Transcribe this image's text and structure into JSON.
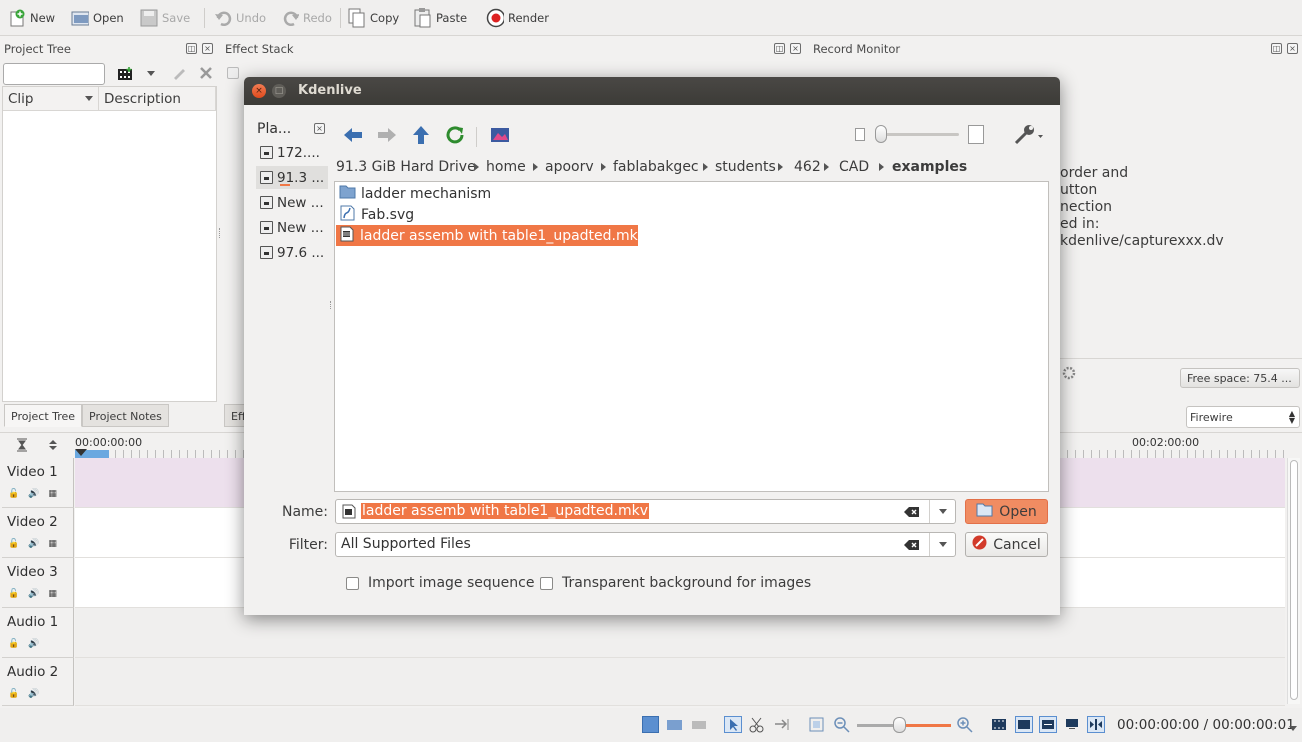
{
  "toolbar": {
    "new": "New",
    "open": "Open",
    "save": "Save",
    "undo": "Undo",
    "redo": "Redo",
    "copy": "Copy",
    "paste": "Paste",
    "render": "Render"
  },
  "project_tree": {
    "title": "Project Tree",
    "columns": [
      "Clip",
      "Description"
    ],
    "tabs": [
      "Project Tree",
      "Project Notes"
    ]
  },
  "effect_stack": {
    "title": "Effect Stack",
    "tab_partial": "Eff"
  },
  "record_monitor": {
    "title": "Record Monitor",
    "text_lines": [
      "order and",
      "utton",
      "nection",
      "ed in:",
      "kdenlive/capturexxx.dv"
    ],
    "free_space": "Free space: 75.4 ...",
    "device": "Firewire"
  },
  "timeline": {
    "start_time": "00:00:00:00",
    "mark_time": "00:02:00:00",
    "tracks": [
      {
        "name": "Video 1",
        "type": "video"
      },
      {
        "name": "Video 2",
        "type": "video"
      },
      {
        "name": "Video 3",
        "type": "video"
      },
      {
        "name": "Audio 1",
        "type": "audio"
      },
      {
        "name": "Audio 2",
        "type": "audio"
      }
    ]
  },
  "statusbar": {
    "timecode": "00:00:00:00 / 00:00:00:01"
  },
  "dialog": {
    "title": "Kdenlive",
    "places_title": "Pla...",
    "places": [
      "172....",
      "91.3 ...",
      "New ...",
      "New ...",
      "97.6 ..."
    ],
    "breadcrumb": [
      "91.3 GiB Hard Drive",
      "home",
      "apoorv",
      "fablabakgec",
      "students",
      "462",
      "CAD",
      "examples"
    ],
    "files": [
      {
        "name": "ladder mechanism",
        "kind": "folder"
      },
      {
        "name": "Fab.svg",
        "kind": "svg"
      },
      {
        "name": "ladder assemb with table1_upadted.mkv",
        "kind": "video",
        "selected": true
      }
    ],
    "name_label": "Name:",
    "name_value": "ladder assemb with table1_upadted.mkv",
    "filter_label": "Filter:",
    "filter_value": "All Supported Files",
    "open_button": "Open",
    "cancel_button": "Cancel",
    "import_sequence": "Import image sequence",
    "transparent_bg": "Transparent background for images"
  },
  "colors": {
    "accent": "#f07746",
    "titlebar": "#3c3b37",
    "video_track": "#ede0ed"
  }
}
